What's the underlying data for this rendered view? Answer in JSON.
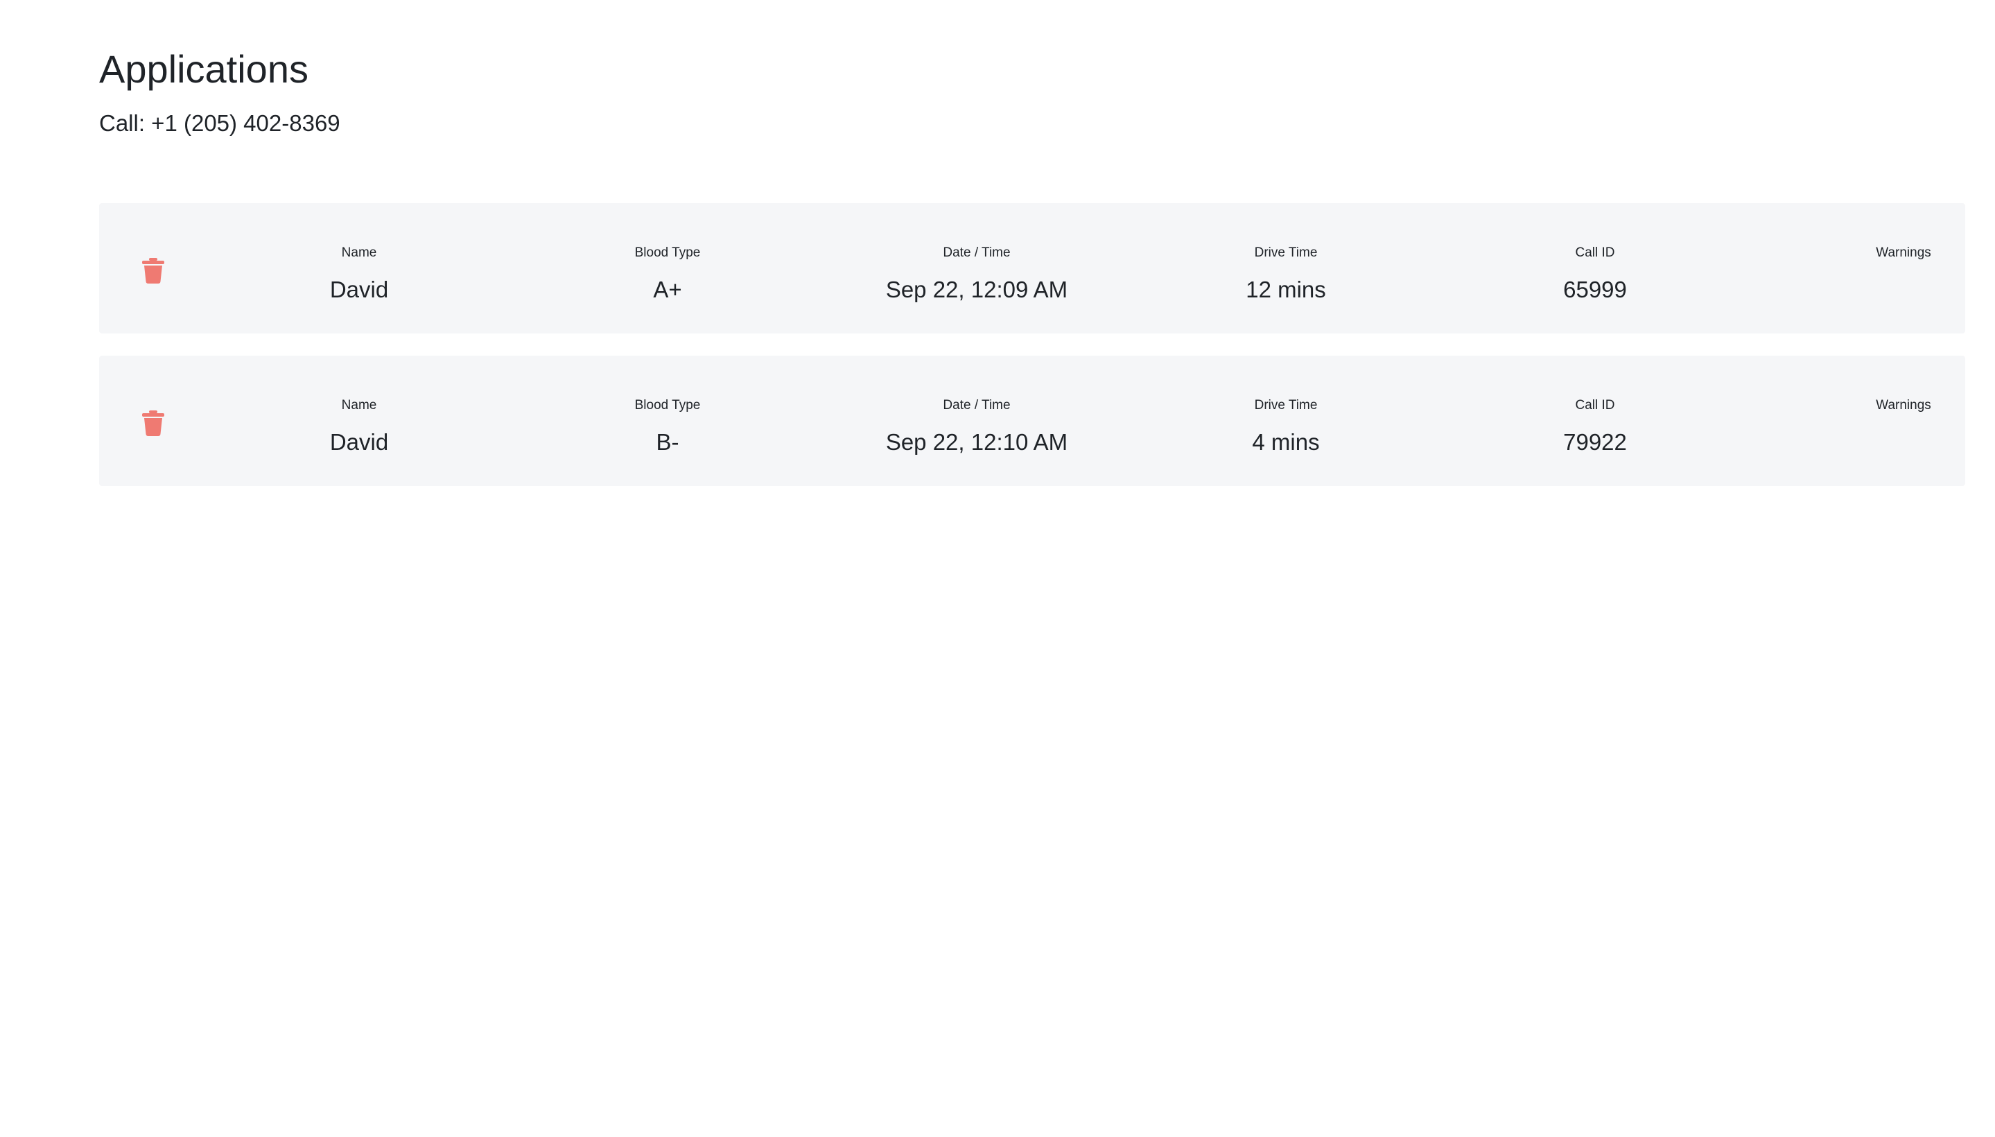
{
  "header": {
    "title": "Applications",
    "call_line": "Call: +1 (205) 402-8369"
  },
  "colors": {
    "accent_delete": "#ef7a72",
    "card_background": "#f5f6f8",
    "text": "#1f2328"
  },
  "icons": {
    "delete": "trash-icon"
  },
  "labels": {
    "name": "Name",
    "blood_type": "Blood Type",
    "date_time": "Date / Time",
    "drive_time": "Drive Time",
    "call_id": "Call ID",
    "warnings": "Warnings"
  },
  "applications": [
    {
      "name": "David",
      "blood_type": "A+",
      "date_time": "Sep 22, 12:09 AM",
      "drive_time": "12 mins",
      "call_id": "65999",
      "warnings": ""
    },
    {
      "name": "David",
      "blood_type": "B-",
      "date_time": "Sep 22, 12:10 AM",
      "drive_time": "4 mins",
      "call_id": "79922",
      "warnings": ""
    }
  ]
}
